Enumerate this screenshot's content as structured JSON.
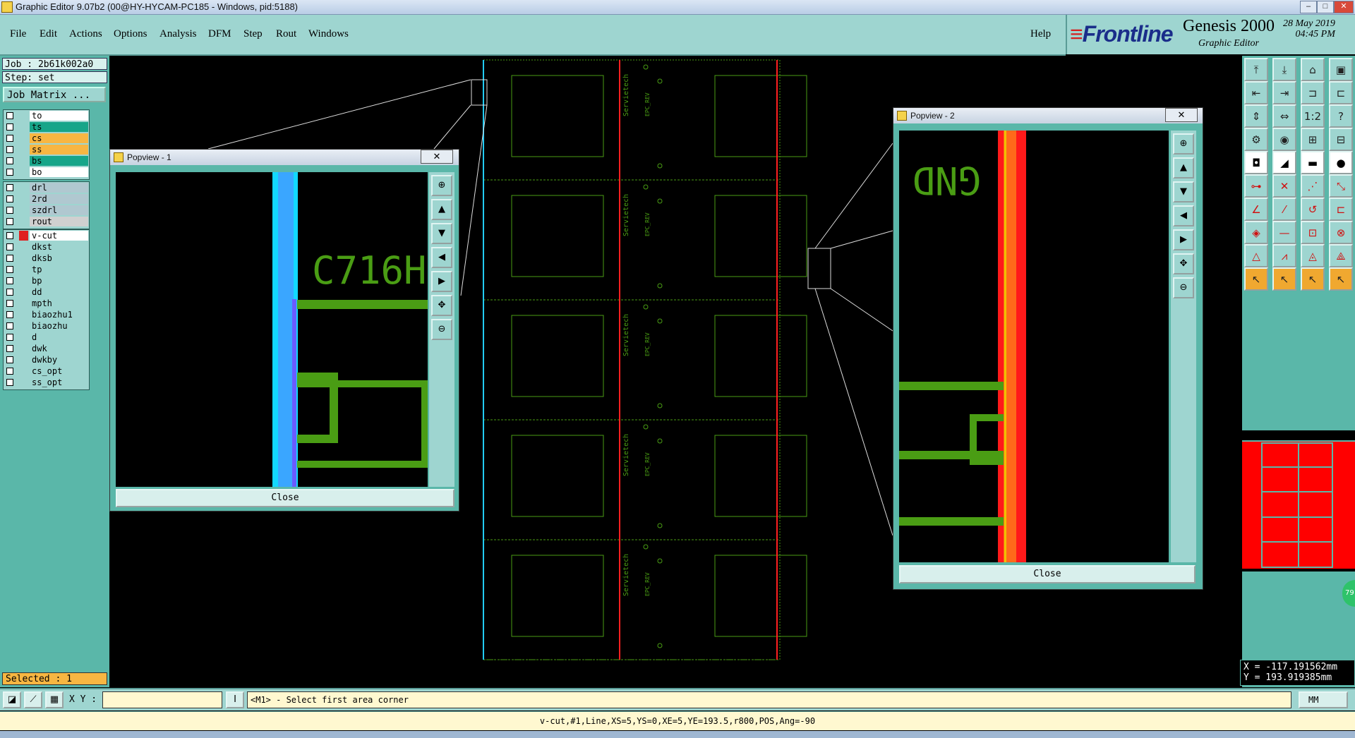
{
  "window": {
    "title": "Graphic Editor 9.07b2 (00@HY-HYCAM-PC185 - Windows, pid:5188)"
  },
  "menu": {
    "items": [
      "File",
      "Edit",
      "Actions",
      "Options",
      "Analysis",
      "DFM",
      "Step",
      "Rout",
      "Windows"
    ],
    "help": "Help"
  },
  "brand": {
    "logo": "Frontline",
    "product": "Genesis 2000",
    "subtitle": "Graphic Editor",
    "date": "28 May 2019",
    "time": "04:45 PM"
  },
  "job": {
    "job": "Job : 2b61k002a0",
    "step": "Step: set",
    "matrix": "Job Matrix ..."
  },
  "layers": {
    "group1": [
      {
        "name": "to",
        "color": "#ffffff"
      },
      {
        "name": "ts",
        "color": "#17a589"
      },
      {
        "name": "cs",
        "color": "#f7b642"
      },
      {
        "name": "ss",
        "color": "#f7b642"
      },
      {
        "name": "bs",
        "color": "#17a589"
      },
      {
        "name": "bo",
        "color": "#ffffff"
      }
    ],
    "group2": [
      {
        "name": "drl",
        "color": "#b0c8d0"
      },
      {
        "name": "2rd",
        "color": "#b0c8d0"
      },
      {
        "name": "szdrl",
        "color": "#b0c8d0"
      },
      {
        "name": "rout",
        "color": "#d0d0d0"
      }
    ],
    "group3": [
      {
        "name": "v-cut",
        "color": "#ffffff",
        "active": true
      },
      {
        "name": "dkst"
      },
      {
        "name": "dksb"
      },
      {
        "name": "tp"
      },
      {
        "name": "bp"
      },
      {
        "name": "dd"
      },
      {
        "name": "mpth"
      },
      {
        "name": "biaozhu1"
      },
      {
        "name": "biaozhu"
      },
      {
        "name": "d"
      },
      {
        "name": "dwk"
      },
      {
        "name": "dwkby"
      },
      {
        "name": "cs_opt"
      },
      {
        "name": "ss_opt"
      }
    ]
  },
  "selected": "Selected : 1",
  "popup1": {
    "title": "Popview - 1",
    "label": "C716H",
    "close": "Close",
    "x": "✕"
  },
  "popup2": {
    "title": "Popview - 2",
    "label": "GND",
    "close": "Close",
    "x": "✕"
  },
  "coords": {
    "x": "X = -117.191562mm",
    "y": "Y = 193.919385mm"
  },
  "status": {
    "xy_label": "X Y :",
    "xy_value": "",
    "prompt": "<M1> - Select first area corner",
    "units": "MM",
    "info": "v-cut,#1,Line,XS=5,YS=0,XE=5,YE=193.5,r800,POS,Ang=-90"
  },
  "board": {
    "labels": [
      "Servietech",
      "EPC_REV"
    ],
    "panels": 5
  },
  "minimap": {
    "percent": "79"
  }
}
